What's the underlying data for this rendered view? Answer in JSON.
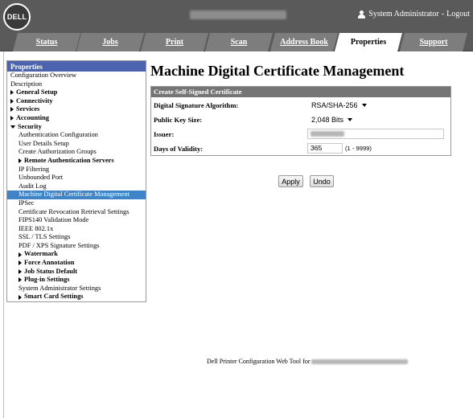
{
  "header": {
    "logo_text": "DELL",
    "user": {
      "name": "System Administrator",
      "separator": "-",
      "logout_label": "Logout"
    }
  },
  "tabs": [
    {
      "label": "Status"
    },
    {
      "label": "Jobs"
    },
    {
      "label": "Print"
    },
    {
      "label": "Scan"
    },
    {
      "label": "Address Book"
    },
    {
      "label": "Properties",
      "active": true
    },
    {
      "label": "Support"
    }
  ],
  "sidebar": {
    "title": "Properties",
    "items": [
      {
        "label": "Configuration Overview"
      },
      {
        "label": "Description"
      },
      {
        "label": "General Setup"
      },
      {
        "label": "Connectivity"
      },
      {
        "label": "Services"
      },
      {
        "label": "Accounting"
      },
      {
        "label": "Security"
      },
      {
        "label": "Authentication Configuration"
      },
      {
        "label": "User Details Setup"
      },
      {
        "label": "Create Authorization Groups"
      },
      {
        "label": "Remote Authentication Servers"
      },
      {
        "label": "IP Filtering"
      },
      {
        "label": "Unbounded Port"
      },
      {
        "label": "Audit Log"
      },
      {
        "label": "Machine Digital Certificate Management"
      },
      {
        "label": "IPSec"
      },
      {
        "label": "Certificate Revocation Retrieval Settings"
      },
      {
        "label": "FIPS140 Validation Mode"
      },
      {
        "label": "IEEE 802.1x"
      },
      {
        "label": "SSL / TLS Settings"
      },
      {
        "label": "PDF / XPS Signature Settings"
      },
      {
        "label": "Watermark"
      },
      {
        "label": "Force Annotation"
      },
      {
        "label": "Job Status Default"
      },
      {
        "label": "Plug-in Settings"
      },
      {
        "label": "System Administrator Settings"
      },
      {
        "label": "Smart Card Settings"
      }
    ]
  },
  "main": {
    "title": "Machine Digital Certificate Management",
    "panel_title": "Create Self-Signed Certificate",
    "fields": {
      "algorithm": {
        "label": "Digital Signature Algorithm:",
        "value": "RSA/SHA-256"
      },
      "key_size": {
        "label": "Public Key Size:",
        "value": "2,048 Bits"
      },
      "issuer": {
        "label": "Issuer:"
      },
      "validity": {
        "label": "Days of Validity:",
        "value": "365",
        "range": "(1 - 9999)"
      }
    },
    "apply_label": "Apply",
    "undo_label": "Undo"
  },
  "footer": {
    "text": "Dell Printer Configuration Web Tool for"
  }
}
